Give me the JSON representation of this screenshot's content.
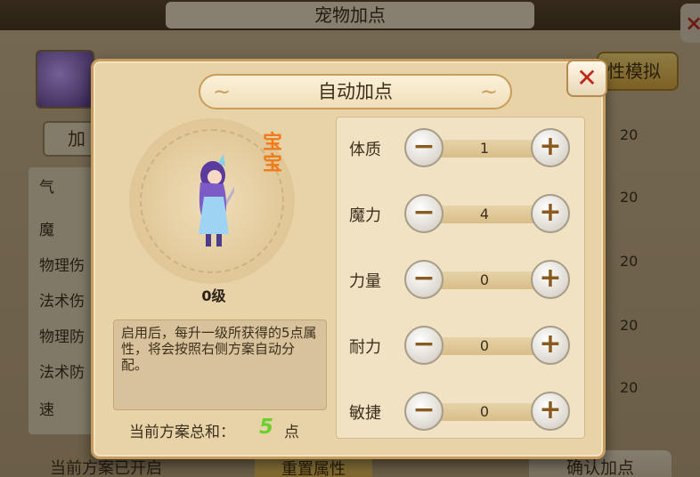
{
  "background": {
    "window_title": "宠物加点",
    "close_symbol": "×",
    "add_button_label": "加",
    "simulate_button_label": "性模拟",
    "stat_labels": [
      "气",
      "魔",
      "物理伤",
      "法术伤",
      "物理防",
      "法术防",
      "速"
    ],
    "stat_values": [
      "20",
      "20",
      "20",
      "20",
      "20"
    ],
    "bottom_left_text": "当前方案已开启",
    "reset_button_label": "重置属性",
    "confirm_button_label": "确认加点"
  },
  "dialog": {
    "title": "自动加点",
    "close_symbol": "✕",
    "pet_tag": "宝宝",
    "pet_level": "0级",
    "description": "启用后，每升一级所获得的5点属性，将会按照右侧方案自动分配。",
    "total_label": "当前方案总和：",
    "total_value": "5",
    "total_unit": "点",
    "attributes": [
      {
        "name": "体质",
        "value": "1"
      },
      {
        "name": "魔力",
        "value": "4"
      },
      {
        "name": "力量",
        "value": "0"
      },
      {
        "name": "耐力",
        "value": "0"
      },
      {
        "name": "敏捷",
        "value": "0"
      }
    ],
    "minus_symbol": "−",
    "plus_symbol": "+"
  }
}
